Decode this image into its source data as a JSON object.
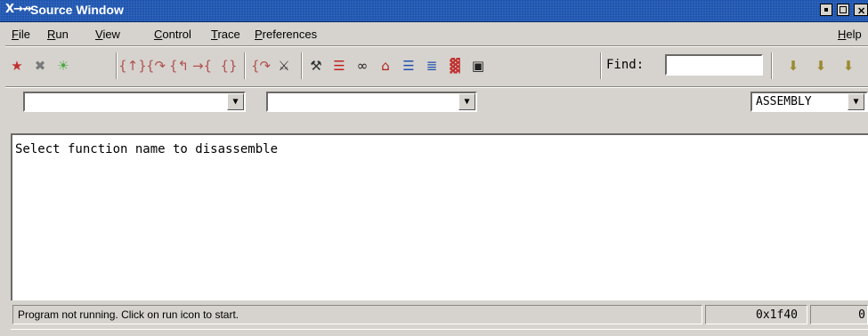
{
  "window": {
    "logo": "X→↛",
    "title": "Source Window"
  },
  "menu": [
    {
      "label": "File",
      "u": "F",
      "rest": "ile"
    },
    {
      "label": "Run",
      "u": "R",
      "rest": "un"
    },
    {
      "label": "View",
      "u": "V",
      "rest": "iew"
    },
    {
      "label": "Control",
      "u": "C",
      "rest": "ontrol"
    },
    {
      "label": "Trace",
      "u": "T",
      "rest": "race"
    },
    {
      "label": "Preferences",
      "u": "P",
      "rest": "references"
    },
    {
      "label": "Help",
      "u": "H",
      "rest": "elp"
    }
  ],
  "toolbar": {
    "icons": [
      {
        "name": "run-icon",
        "glyph": "★",
        "color": "#c03030"
      },
      {
        "name": "stop-icon",
        "glyph": "✖",
        "color": "#7a7a7a"
      },
      {
        "name": "attach-icon",
        "glyph": "☀",
        "color": "#4aa840"
      },
      {
        "name": "step-icon",
        "glyph": "{↑}",
        "color": "#b05050"
      },
      {
        "name": "next-icon",
        "glyph": "{↷",
        "color": "#b05050"
      },
      {
        "name": "finish-icon",
        "glyph": "{↰",
        "color": "#b05050"
      },
      {
        "name": "continue-icon",
        "glyph": "→{",
        "color": "#b05050"
      },
      {
        "name": "stepi-icon",
        "glyph": "{}",
        "color": "#b05050"
      },
      {
        "name": "nexti-icon",
        "glyph": "{↷",
        "color": "#b05050"
      },
      {
        "name": "up-stack-icon",
        "glyph": "⚔",
        "color": "#303030"
      },
      {
        "name": "down-stack-icon",
        "glyph": "⚒",
        "color": "#303030"
      },
      {
        "name": "registers-icon",
        "glyph": "☰",
        "color": "#c02020"
      },
      {
        "name": "memory-icon",
        "glyph": "∞",
        "color": "#202020"
      },
      {
        "name": "home-icon",
        "glyph": "⌂",
        "color": "#b02020"
      },
      {
        "name": "breakpoints-icon",
        "glyph": "☰",
        "color": "#2050b0"
      },
      {
        "name": "watch-icon",
        "glyph": "≣",
        "color": "#2050b0"
      },
      {
        "name": "stack-icon",
        "glyph": "▓",
        "color": "#c03030"
      },
      {
        "name": "console-icon",
        "glyph": "▣",
        "color": "#202020"
      }
    ],
    "find_label": "Find:",
    "find_value": "",
    "right_icons": [
      {
        "name": "prev-match-icon",
        "glyph": "⬇",
        "color": "#9a8a30"
      },
      {
        "name": "next-match-icon",
        "glyph": "⬇",
        "color": "#9a8a30"
      },
      {
        "name": "search-options-icon",
        "glyph": "⬇",
        "color": "#9a8a30"
      }
    ]
  },
  "combos": {
    "file": "",
    "function": "",
    "mode": "ASSEMBLY"
  },
  "source": {
    "text": "Select function name to disassemble"
  },
  "status": {
    "message": "Program not running. Click on run icon to start.",
    "address": "0x1f40",
    "line": "0"
  }
}
